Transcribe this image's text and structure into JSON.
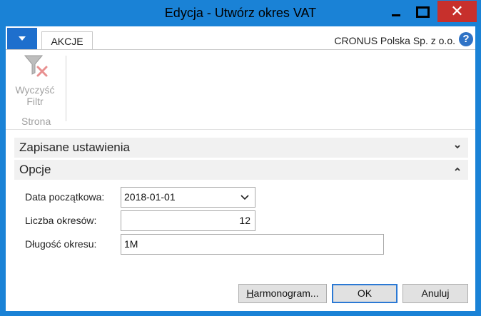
{
  "window": {
    "title": "Edycja - Utwórz okres VAT",
    "close_glyph": "✕"
  },
  "ribbon": {
    "tab_label": "AKCJE",
    "company": "CRONUS Polska Sp. z o.o.",
    "help_glyph": "?",
    "action_line1": "Wyczyść",
    "action_line2": "Filtr",
    "group_label": "Strona"
  },
  "sections": {
    "saved_settings": "Zapisane ustawienia",
    "options": "Opcje"
  },
  "fields": {
    "start_date_label": "Data początkowa:",
    "start_date_value": "2018-01-01",
    "period_count_label": "Liczba okresów:",
    "period_count_value": "12",
    "period_length_label": "Długość okresu:",
    "period_length_value": "1M"
  },
  "buttons": {
    "schedule_first": "H",
    "schedule_rest": "armonogram...",
    "ok": "OK",
    "cancel": "Anuluj"
  },
  "colors": {
    "titlebar": "#1a82d6",
    "close": "#c7302c",
    "accent": "#1e6fcd"
  },
  "icons": [
    "minimize-icon",
    "maximize-icon",
    "close-icon",
    "menu-dropdown-icon",
    "help-icon",
    "clear-filter-icon",
    "chevron-down-icon",
    "chevron-up-icon"
  ]
}
